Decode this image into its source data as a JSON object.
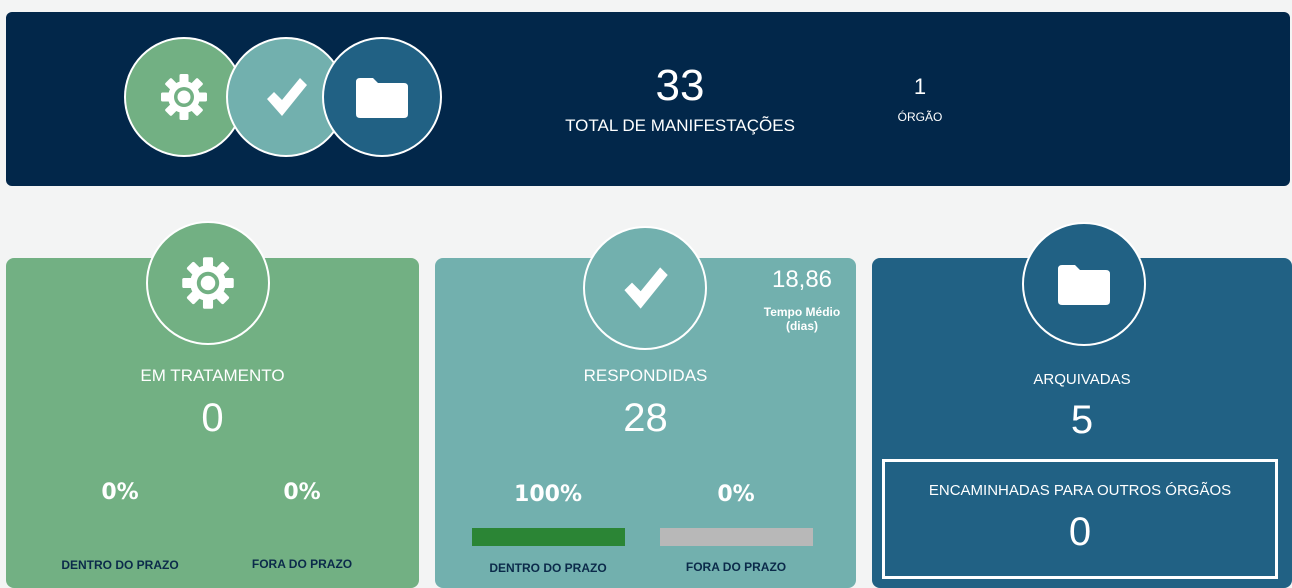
{
  "summary": {
    "total_value": "33",
    "total_label": "TOTAL DE MANIFESTAÇÕES",
    "orgao_value": "1",
    "orgao_label": "ÓRGÃO"
  },
  "cards": {
    "tratamento": {
      "title": "EM TRATAMENTO",
      "value": "0",
      "dentro_pct": "0%",
      "fora_pct": "0%",
      "dentro_label": "DENTRO DO PRAZO",
      "fora_label": "FORA DO PRAZO"
    },
    "respondidas": {
      "title": "RESPONDIDAS",
      "value": "28",
      "tempo_value": "18,86",
      "tempo_label_1": "Tempo Médio",
      "tempo_label_2": "(dias)",
      "dentro_pct": "100%",
      "fora_pct": "0%",
      "dentro_label": "DENTRO DO PRAZO",
      "fora_label": "FORA DO PRAZO",
      "dentro_fraction": 1.0,
      "fora_fraction": 0.0
    },
    "arquivadas": {
      "title": "ARQUIVADAS",
      "value": "5",
      "encaminhadas_label": "ENCAMINHADAS PARA OUTROS ÓRGÃOS",
      "encaminhadas_value": "0"
    }
  },
  "icons": {
    "tratamento": "gear-icon",
    "respondidas": "checkmark-icon",
    "arquivadas": "folder-icon"
  },
  "colors": {
    "banner": "#02274a",
    "green": "#72b083",
    "teal": "#72b0ae",
    "blue": "#216184",
    "bar_dentro": "#2b8535",
    "bar_fora": "#b8b8b8",
    "label_dark": "#0b2a4a"
  }
}
